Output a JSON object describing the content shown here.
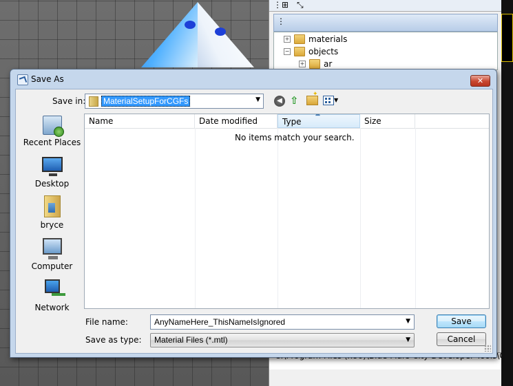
{
  "background": {
    "tree": [
      "materials",
      "objects",
      "ar"
    ],
    "status_path": "C:\\Program Files (x86)\\Blue Mars City Developer Tools\\Game\\Obje"
  },
  "dialog": {
    "title": "Save As",
    "close_label": "✕",
    "save_in": {
      "label": "Save in:",
      "value": "MaterialSetupForCGFs"
    },
    "places": [
      {
        "label": "Recent Places",
        "icon": "recent-places-icon"
      },
      {
        "label": "Desktop",
        "icon": "desktop-icon"
      },
      {
        "label": "bryce",
        "icon": "user-folder-icon"
      },
      {
        "label": "Computer",
        "icon": "computer-icon"
      },
      {
        "label": "Network",
        "icon": "network-icon"
      }
    ],
    "columns": [
      "Name",
      "Date modified",
      "Type",
      "Size"
    ],
    "empty_message": "No items match your search.",
    "file_name": {
      "label": "File name:",
      "value": "AnyNameHere_ThisNameIsIgnored"
    },
    "save_as_type": {
      "label": "Save as type:",
      "value": "Material Files (*.mtl)"
    },
    "buttons": {
      "save": "Save",
      "cancel": "Cancel"
    }
  },
  "colors": {
    "selection": "#3399ff",
    "frame": "#c5d7ec",
    "close_button": "#c8462f"
  }
}
